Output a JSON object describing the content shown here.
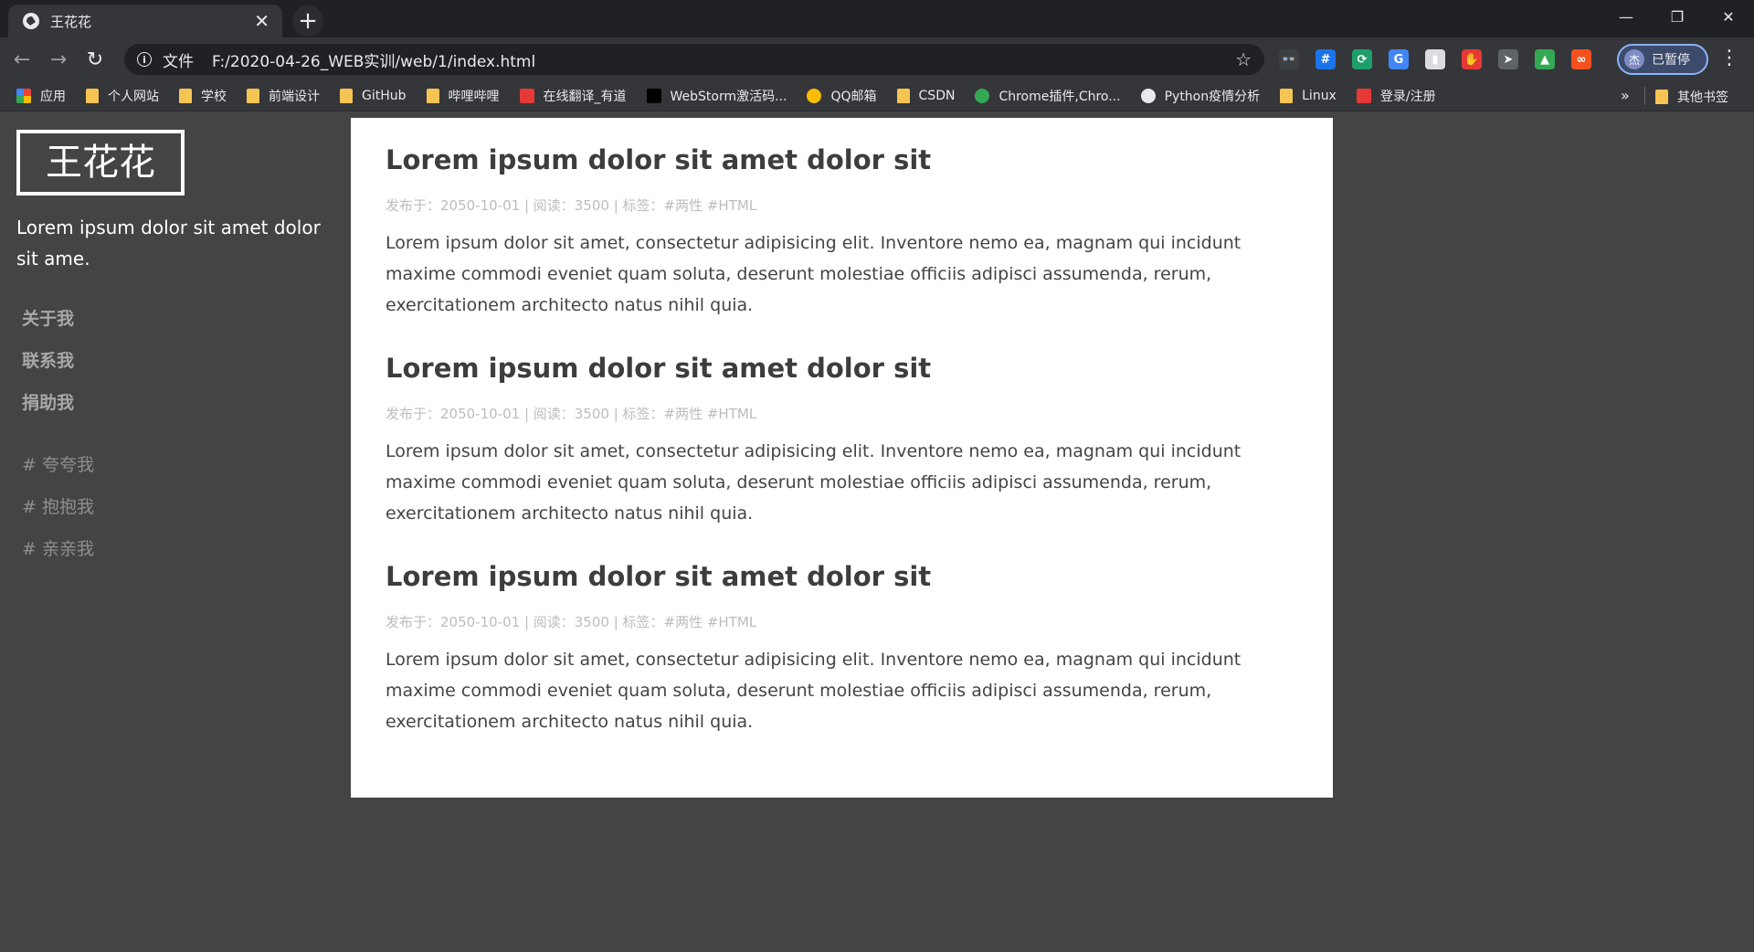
{
  "browser": {
    "tab": {
      "title": "王花花",
      "close_glyph": "✕"
    },
    "new_tab_glyph": "+",
    "window_controls": {
      "minimize": "—",
      "restore": "❐",
      "close": "✕"
    },
    "nav": {
      "back": "←",
      "forward": "→",
      "reload": "↻"
    },
    "address": {
      "scheme_label": "文件",
      "url": "F:/2020-04-26_WEB实训/web/1/index.html"
    },
    "star_glyph": "☆",
    "extensions": [
      {
        "name": "spy-icon",
        "glyph": "👓",
        "color": "#3c4043"
      },
      {
        "name": "hashtag-icon",
        "glyph": "#",
        "color": "#1a73e8"
      },
      {
        "name": "refresh-ext-icon",
        "glyph": "⟳",
        "color": "#1e9e6a"
      },
      {
        "name": "translate-icon",
        "glyph": "G",
        "color": "#4285f4"
      },
      {
        "name": "book-icon",
        "glyph": "▮",
        "color": "#dadce0"
      },
      {
        "name": "hand-icon",
        "glyph": "✋",
        "color": "#e53935"
      },
      {
        "name": "cursor-icon",
        "glyph": "➤",
        "color": "#5f6368"
      },
      {
        "name": "drive-icon",
        "glyph": "▲",
        "color": "#34a853"
      },
      {
        "name": "infinity-icon",
        "glyph": "∞",
        "color": "#f4511e"
      }
    ],
    "profile": {
      "avatar": "杰",
      "status": "已暂停"
    },
    "menu_glyph": "⋮",
    "bookmarks": [
      {
        "label": "应用",
        "icon": "apps-icon",
        "color": "#ea4335"
      },
      {
        "label": "个人网站",
        "icon": "folder-icon",
        "color": "#f6c453"
      },
      {
        "label": "学校",
        "icon": "folder-icon",
        "color": "#f6c453"
      },
      {
        "label": "前端设计",
        "icon": "folder-icon",
        "color": "#f6c453"
      },
      {
        "label": "GitHub",
        "icon": "folder-icon",
        "color": "#f6c453"
      },
      {
        "label": "哔哩哔哩",
        "icon": "folder-icon",
        "color": "#f6c453"
      },
      {
        "label": "在线翻译_有道",
        "icon": "youdao-icon",
        "color": "#e53935"
      },
      {
        "label": "WebStorm激活码...",
        "icon": "jetbrains-icon",
        "color": "#000000"
      },
      {
        "label": "QQ邮箱",
        "icon": "qqmail-icon",
        "color": "#fbbc04"
      },
      {
        "label": "CSDN",
        "icon": "folder-icon",
        "color": "#f6c453"
      },
      {
        "label": "Chrome插件,Chro...",
        "icon": "chrome-icon",
        "color": "#34a853"
      },
      {
        "label": "Python疫情分析",
        "icon": "globe-icon",
        "color": "#e8eaed"
      },
      {
        "label": "Linux",
        "icon": "folder-icon",
        "color": "#f6c453"
      },
      {
        "label": "登录/注册",
        "icon": "csdn-icon",
        "color": "#e53935"
      }
    ],
    "bookmarks_more": "»",
    "other_bookmarks": "其他书签"
  },
  "page": {
    "logo": "王花花",
    "description": "Lorem ipsum dolor sit amet dolor sit ame.",
    "nav": [
      "关于我",
      "联系我",
      "捐助我"
    ],
    "tags": [
      "# 夸夸我",
      "# 抱抱我",
      "# 亲亲我"
    ],
    "posts": [
      {
        "title": "Lorem ipsum dolor sit amet dolor sit",
        "meta": "发布于：2050-10-01 | 阅读：3500 | 标签：#两性 #HTML",
        "body": "Lorem ipsum dolor sit amet, consectetur adipisicing elit. Inventore nemo ea, magnam qui incidunt maxime commodi eveniet quam soluta, deserunt molestiae officiis adipisci assumenda, rerum, exercitationem architecto natus nihil quia."
      },
      {
        "title": "Lorem ipsum dolor sit amet dolor sit",
        "meta": "发布于：2050-10-01 | 阅读：3500 | 标签：#两性 #HTML",
        "body": "Lorem ipsum dolor sit amet, consectetur adipisicing elit. Inventore nemo ea, magnam qui incidunt maxime commodi eveniet quam soluta, deserunt molestiae officiis adipisci assumenda, rerum, exercitationem architecto natus nihil quia."
      },
      {
        "title": "Lorem ipsum dolor sit amet dolor sit",
        "meta": "发布于：2050-10-01 | 阅读：3500 | 标签：#两性 #HTML",
        "body": "Lorem ipsum dolor sit amet, consectetur adipisicing elit. Inventore nemo ea, magnam qui incidunt maxime commodi eveniet quam soluta, deserunt molestiae officiis adipisci assumenda, rerum, exercitationem architecto natus nihil quia."
      }
    ]
  },
  "colors": {
    "page_background": "#444444",
    "content_background": "#ffffff",
    "browser_frame": "#202124",
    "toolbar": "#35363a"
  }
}
